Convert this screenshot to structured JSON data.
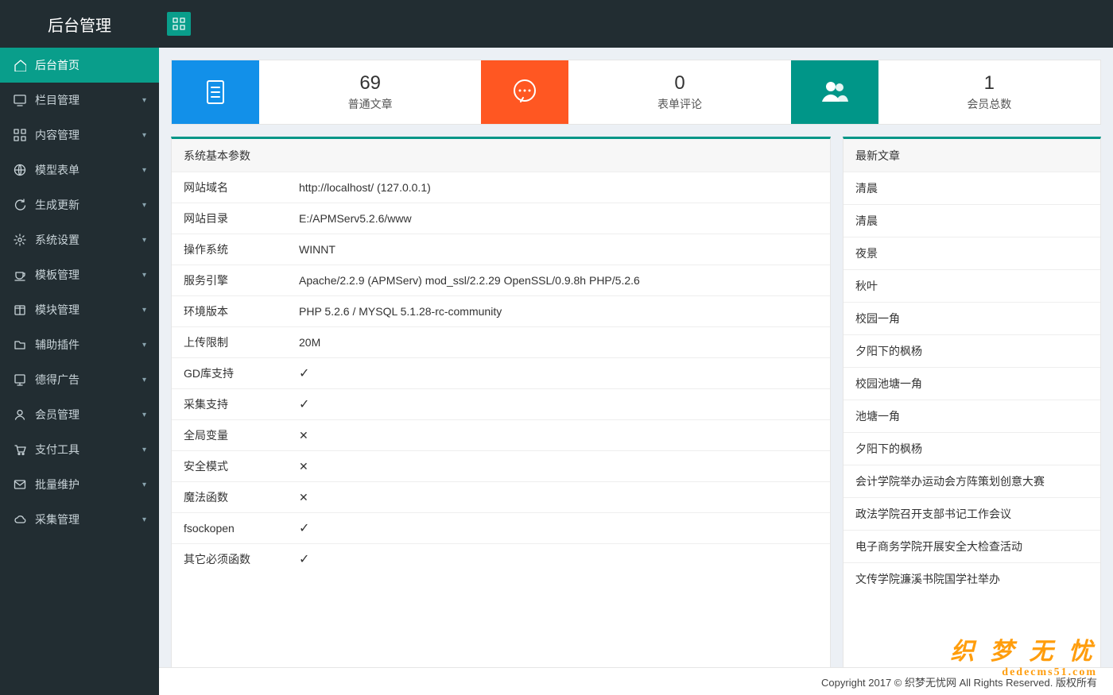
{
  "header": {
    "title": "后台管理"
  },
  "sidebar": {
    "items": [
      {
        "label": "后台首页",
        "icon": "home",
        "active": true,
        "expandable": false
      },
      {
        "label": "栏目管理",
        "icon": "monitor",
        "active": false,
        "expandable": true
      },
      {
        "label": "内容管理",
        "icon": "grid",
        "active": false,
        "expandable": true
      },
      {
        "label": "模型表单",
        "icon": "globe",
        "active": false,
        "expandable": true
      },
      {
        "label": "生成更新",
        "icon": "refresh",
        "active": false,
        "expandable": true
      },
      {
        "label": "系统设置",
        "icon": "gear",
        "active": false,
        "expandable": true
      },
      {
        "label": "模板管理",
        "icon": "cup",
        "active": false,
        "expandable": true
      },
      {
        "label": "模块管理",
        "icon": "package",
        "active": false,
        "expandable": true
      },
      {
        "label": "辅助插件",
        "icon": "folder",
        "active": false,
        "expandable": true
      },
      {
        "label": "德得广告",
        "icon": "board",
        "active": false,
        "expandable": true
      },
      {
        "label": "会员管理",
        "icon": "user",
        "active": false,
        "expandable": true
      },
      {
        "label": "支付工具",
        "icon": "cart",
        "active": false,
        "expandable": true
      },
      {
        "label": "批量维护",
        "icon": "mail",
        "active": false,
        "expandable": true
      },
      {
        "label": "采集管理",
        "icon": "cloud",
        "active": false,
        "expandable": true
      }
    ]
  },
  "stats": [
    {
      "num": "69",
      "label": "普通文章",
      "icon": "doc",
      "color": "blue"
    },
    {
      "num": "0",
      "label": "表单评论",
      "icon": "chat",
      "color": "orange"
    },
    {
      "num": "1",
      "label": "会员总数",
      "icon": "members",
      "color": "teal"
    }
  ],
  "params_panel": {
    "title": "系统基本参数",
    "rows": [
      {
        "label": "网站域名",
        "value": "http://localhost/ (127.0.0.1)",
        "type": "text"
      },
      {
        "label": "网站目录",
        "value": "E:/APMServ5.2.6/www",
        "type": "text"
      },
      {
        "label": "操作系统",
        "value": "WINNT",
        "type": "text"
      },
      {
        "label": "服务引擎",
        "value": "Apache/2.2.9 (APMServ) mod_ssl/2.2.29 OpenSSL/0.9.8h PHP/5.2.6",
        "type": "text"
      },
      {
        "label": "环境版本",
        "value": "PHP 5.2.6 / MYSQL 5.1.28-rc-community",
        "type": "text"
      },
      {
        "label": "上传限制",
        "value": "20M",
        "type": "text"
      },
      {
        "label": "GD库支持",
        "value": "",
        "type": "check"
      },
      {
        "label": "采集支持",
        "value": "",
        "type": "check"
      },
      {
        "label": "全局变量",
        "value": "",
        "type": "x"
      },
      {
        "label": "安全模式",
        "value": "",
        "type": "x"
      },
      {
        "label": "魔法函数",
        "value": "",
        "type": "x"
      },
      {
        "label": "fsockopen",
        "value": "",
        "type": "check"
      },
      {
        "label": "其它必须函数",
        "value": "",
        "type": "check"
      }
    ]
  },
  "articles_panel": {
    "title": "最新文章",
    "items": [
      "清晨",
      "清晨",
      "夜景",
      "秋叶",
      "校园一角",
      "夕阳下的枫杨",
      "校园池塘一角",
      "池塘一角",
      "夕阳下的枫杨",
      "会计学院举办运动会方阵策划创意大赛",
      "政法学院召开支部书记工作会议",
      "电子商务学院开展安全大检查活动",
      "文传学院濂溪书院国学社举办"
    ]
  },
  "footer": {
    "text": "Copyright 2017 © 织梦无忧网 All Rights Reserved. 版权所有"
  },
  "watermark": {
    "main": "织 梦 无 忧",
    "sub": "dedecms51.com"
  }
}
